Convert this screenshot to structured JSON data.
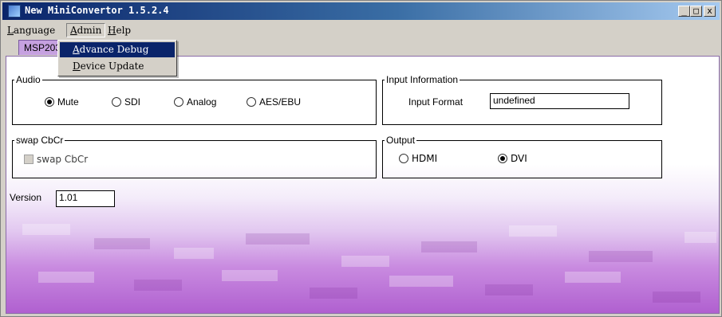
{
  "window": {
    "title": "New MiniConvertor 1.5.2.4",
    "buttons": {
      "minimize": "_",
      "maximize": "□",
      "close": "x"
    }
  },
  "menubar": {
    "items": [
      {
        "label": "Language",
        "mnemonic": "L",
        "rest": "anguage"
      },
      {
        "label": "Admin",
        "mnemonic": "A",
        "rest": "dmin"
      },
      {
        "label": "Help",
        "mnemonic": "H",
        "rest": "elp"
      }
    ]
  },
  "admin_menu": {
    "items": [
      {
        "label": "Advance Debug",
        "mnemonic": "A",
        "rest": "dvance Debug",
        "highlighted": true
      },
      {
        "label": "Device Update",
        "mnemonic": "D",
        "rest": "evice Update",
        "highlighted": false
      }
    ]
  },
  "tab": {
    "label": "MSP203"
  },
  "audio": {
    "legend": "Audio",
    "options": [
      {
        "label": "Mute",
        "checked": true
      },
      {
        "label": "SDI",
        "checked": false
      },
      {
        "label": "Analog",
        "checked": false
      },
      {
        "label": "AES/EBU",
        "checked": false
      }
    ]
  },
  "input_info": {
    "legend": "Input Information",
    "format_label": "Input Format",
    "format_value": "undefined"
  },
  "swap": {
    "legend": "swap CbCr",
    "checkbox_label": "swap CbCr",
    "checked": false,
    "enabled": false
  },
  "output": {
    "legend": "Output",
    "options": [
      {
        "label": "HDMI",
        "checked": false
      },
      {
        "label": "DVI",
        "checked": true
      }
    ]
  },
  "version": {
    "label": "Version",
    "value": "1.01"
  },
  "colors": {
    "title_start": "#0a246a",
    "title_end": "#a6caf0",
    "tab_bg": "#c6a1e0",
    "menu_highlight": "#0a246a",
    "bg_purple": "#b060d0"
  }
}
